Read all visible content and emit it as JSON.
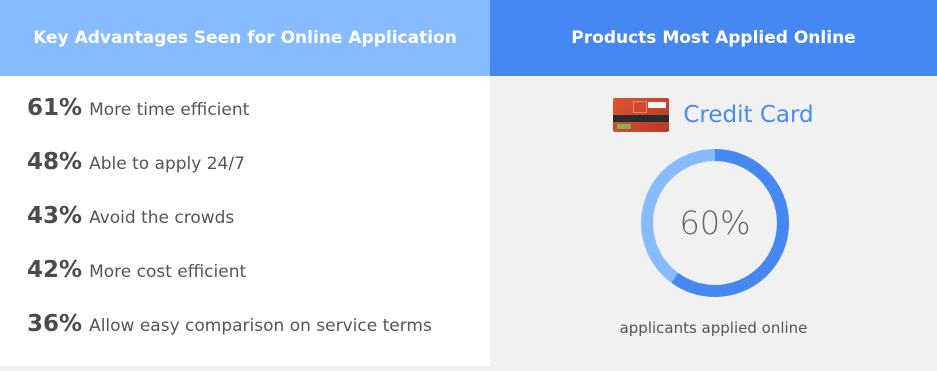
{
  "left_panel": {
    "title": "Key Advantages Seen for Online Application",
    "stats": [
      {
        "percent": "61%",
        "label": "More time efficient"
      },
      {
        "percent": "48%",
        "label": "Able to apply 24/7"
      },
      {
        "percent": "43%",
        "label": "Avoid the crowds"
      },
      {
        "percent": "42%",
        "label": "More cost efficient"
      },
      {
        "percent": "36%",
        "label": "Allow easy comparison on service terms"
      }
    ]
  },
  "right_panel": {
    "title": "Products Most Applied Online",
    "product": {
      "icon": "credit-card-icon",
      "name": "Credit Card"
    },
    "donut": {
      "value_label": "60%",
      "fraction": 0.6,
      "colors": {
        "filled": "#4688f1",
        "remaining": "#86bcff"
      }
    },
    "caption": "applicants applied online"
  },
  "colors": {
    "left_header": "#86bcff",
    "right_header": "#4688f1",
    "accent_text": "#4a8af0"
  }
}
